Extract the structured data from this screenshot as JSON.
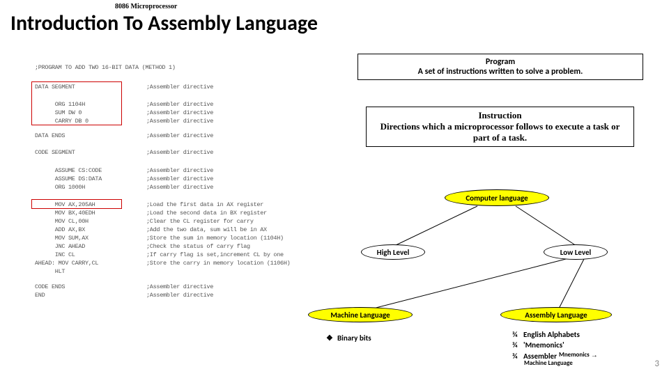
{
  "header_small": "8086 Microprocessor",
  "title": "Introduction To Assembly Language",
  "boxes": {
    "program": {
      "title": "Program",
      "body": "A set of instructions written to solve a problem."
    },
    "instruction": {
      "title": "Instruction",
      "body": "Directions which a microprocessor follows to execute a task or part of a task."
    }
  },
  "nodes": {
    "root": "Computer language",
    "high": "High Level",
    "low": "Low Level",
    "machine": "Machine Language",
    "assembly": "Assembly Language"
  },
  "machine_bullet": {
    "mark": "❖",
    "text": "Binary bits"
  },
  "asm_bullets": {
    "mark": "¾",
    "items": [
      "English Alphabets",
      "'Mnemonics'",
      "Assembler"
    ]
  },
  "asm_trailing": {
    "mnemonics": "Mnemonics",
    "arrow": "→",
    "ml": "Machine Language"
  },
  "code": {
    "l0": ";PROGRAM TO ADD TWO 16-BIT DATA (METHOD 1)",
    "l1a": "DATA SEGMENT",
    "l1b": ";Assembler directive",
    "l2a": "      ORG 1104H",
    "l2b": ";Assembler directive",
    "l3a": "      SUM DW 0",
    "l3b": ";Assembler directive",
    "l4a": "      CARRY DB 0",
    "l4b": ";Assembler directive",
    "l5a": "DATA ENDS",
    "l5b": ";Assembler directive",
    "l6a": "CODE SEGMENT",
    "l6b": ";Assembler directive",
    "l7a": "      ASSUME CS:CODE",
    "l7b": ";Assembler directive",
    "l8a": "      ASSUME DS:DATA",
    "l8b": ";Assembler directive",
    "l9a": "      ORG 1000H",
    "l9b": ";Assembler directive",
    "l10a": "      MOV AX,205AH",
    "l10b": ";Load the first data in AX register",
    "l11a": "      MOV BX,40EDH",
    "l11b": ";Load the second data in BX register",
    "l12a": "      MOV CL,00H",
    "l12b": ";Clear the CL register for carry",
    "l13a": "      ADD AX,BX",
    "l13b": ";Add the two data, sum will be in AX",
    "l14a": "      MOV SUM,AX",
    "l14b": ";Store the sum in memory location (1104H)",
    "l15a": "      JNC AHEAD",
    "l15b": ";Check the status of carry flag",
    "l16a": "      INC CL",
    "l16b": ";If carry flag is set,increment CL by one",
    "l17a": "AHEAD: MOV CARRY,CL",
    "l17b": ";Store the carry in memory location (1106H)",
    "l18a": "      HLT",
    "l18b": "",
    "l19a": "CODE ENDS",
    "l19b": ";Assembler directive",
    "l20a": "END",
    "l20b": ";Assembler directive"
  },
  "page_number": "3"
}
